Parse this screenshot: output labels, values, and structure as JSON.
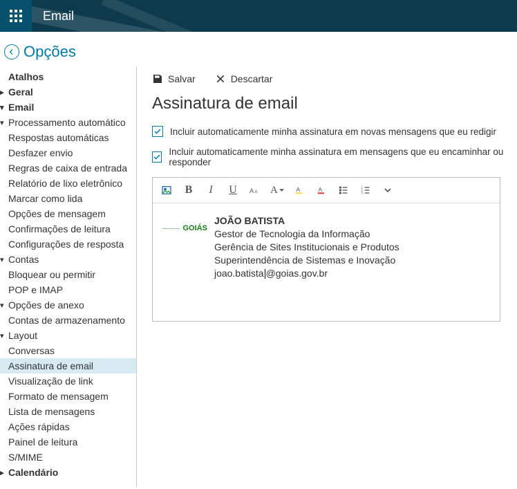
{
  "topbar": {
    "title": "Email"
  },
  "back": {
    "label": "Opções"
  },
  "sidebar": {
    "shortcuts": "Atalhos",
    "general": "Geral",
    "email": "Email",
    "auto_proc": "Processamento automático",
    "auto_replies": "Respostas automáticas",
    "undo_send": "Desfazer envio",
    "inbox_rules": "Regras de caixa de entrada",
    "junk_report": "Relatório de lixo eletrônico",
    "mark_read": "Marcar como lida",
    "msg_options": "Opções de mensagem",
    "read_confirm": "Confirmações de leitura",
    "reply_settings": "Configurações de resposta",
    "accounts": "Contas",
    "block_allow": "Bloquear ou permitir",
    "pop_imap": "POP e IMAP",
    "attach_opts": "Opções de anexo",
    "storage_accts": "Contas de armazenamento",
    "layout": "Layout",
    "conversations": "Conversas",
    "email_signature": "Assinatura de email",
    "link_preview": "Visualização de link",
    "msg_format": "Formato de mensagem",
    "msg_list": "Lista de mensagens",
    "quick_actions": "Ações rápidas",
    "reading_pane": "Painel de leitura",
    "smime": "S/MIME",
    "calendar": "Calendário"
  },
  "actions": {
    "save": "Salvar",
    "discard": "Descartar"
  },
  "page": {
    "title": "Assinatura de email"
  },
  "checks": {
    "include_new": "Incluir automaticamente minha assinatura em novas mensagens que eu redigir",
    "include_fwd": "Incluir automaticamente minha assinatura em mensagens que eu encaminhar ou responder"
  },
  "signature": {
    "logo1_text": "———",
    "logo2_text": "GOIÁS",
    "name": "JOÃO BATISTA",
    "line1": "Gestor de Tecnologia da Informação",
    "line2": "Gerência de Sites Institucionais e Produtos",
    "line3": "Superintendência de Sistemas e Inovação",
    "email_a": "joao.batista",
    "email_b": "@goias.gov.br"
  }
}
